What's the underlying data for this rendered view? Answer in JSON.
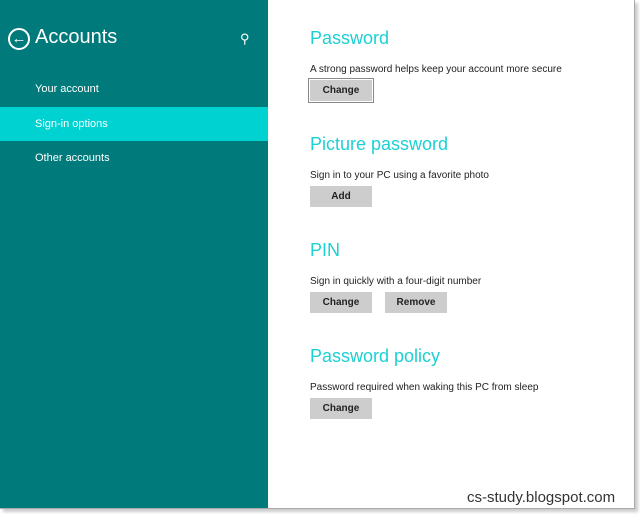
{
  "sidebar": {
    "title": "Accounts",
    "items": [
      {
        "label": "Your account"
      },
      {
        "label": "Sign-in options",
        "selected": true
      },
      {
        "label": "Other accounts"
      }
    ]
  },
  "sections": [
    {
      "heading": "Password",
      "description": "A strong password helps keep your account more secure",
      "buttons": [
        "Change"
      ]
    },
    {
      "heading": "Picture password",
      "description": "Sign in to your PC using a favorite photo",
      "buttons": [
        "Add"
      ]
    },
    {
      "heading": "PIN",
      "description": "Sign in quickly with a four-digit number",
      "buttons": [
        "Change",
        "Remove"
      ]
    },
    {
      "heading": "Password policy",
      "description": "Password required when waking this PC from sleep",
      "buttons": [
        "Change"
      ]
    }
  ],
  "watermark": "cs-study.blogspot.com",
  "colors": {
    "sidebar": "#007a7a",
    "selected": "#00d2d2",
    "heading": "#1cd0d4"
  }
}
